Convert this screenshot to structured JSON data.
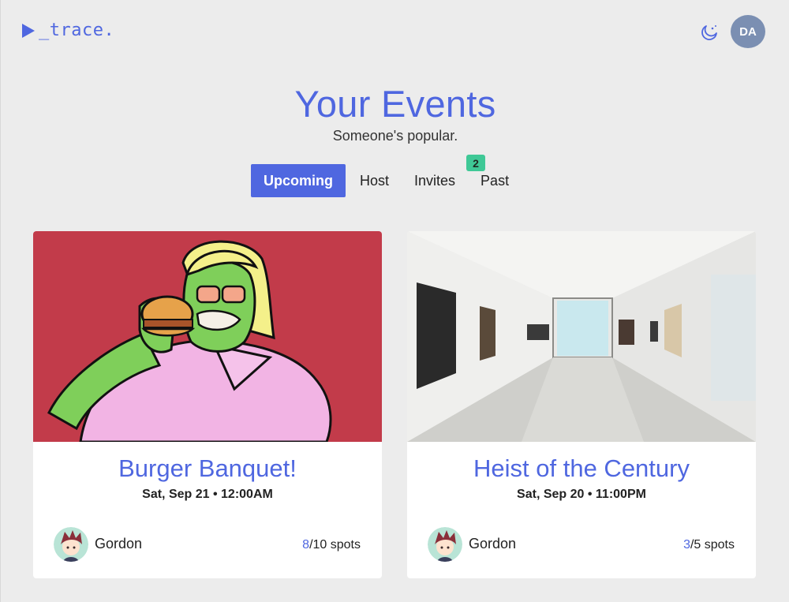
{
  "header": {
    "logo_text": "_trace.",
    "logo_icon": "play-triangle-icon",
    "theme_icon": "moon-icon",
    "user_initials": "DA"
  },
  "hero": {
    "title": "Your Events",
    "subtitle": "Someone's popular."
  },
  "tabs": [
    {
      "label": "Upcoming",
      "active": true
    },
    {
      "label": "Host",
      "active": false
    },
    {
      "label": "Invites",
      "active": false,
      "badge": "2"
    },
    {
      "label": "Past",
      "active": false
    }
  ],
  "events": [
    {
      "title": "Burger Banquet!",
      "date": "Sat, Sep 21 • 12:00AM",
      "host": "Gordon",
      "spots_taken": "8",
      "spots_rest": "/10 spots"
    },
    {
      "title": "Heist of the Century",
      "date": "Sat, Sep 20 • 11:00PM",
      "host": "Gordon",
      "spots_taken": "3",
      "spots_rest": "/5 spots"
    }
  ],
  "colors": {
    "accent": "#4f67e0",
    "badge": "#3fc896",
    "background": "#ececec",
    "avatar": "#7b8fb2"
  }
}
